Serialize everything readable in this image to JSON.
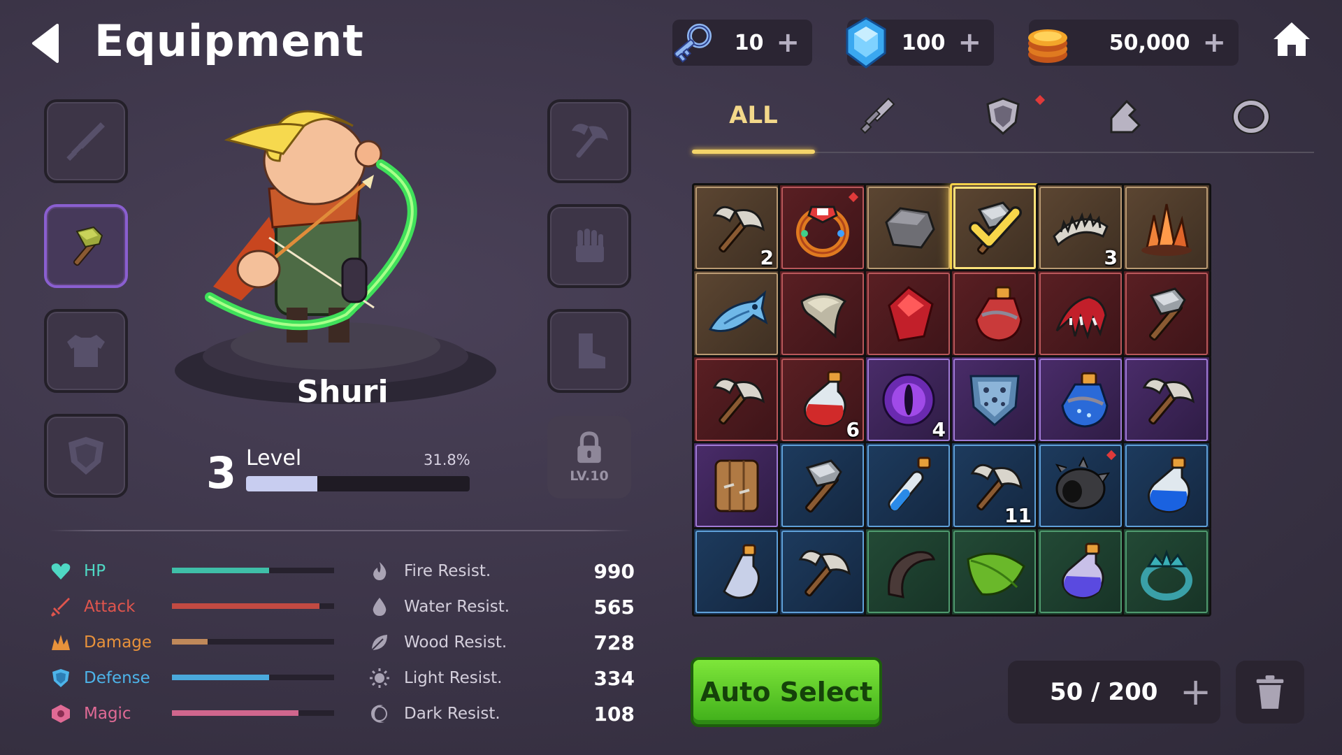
{
  "header": {
    "title": "Equipment",
    "currencies": [
      {
        "name": "keys",
        "icon": "key-icon",
        "value": "10"
      },
      {
        "name": "gems",
        "icon": "gem-icon",
        "value": "100"
      },
      {
        "name": "coins",
        "icon": "coin-icon",
        "value": "50,000"
      }
    ],
    "plus": "+"
  },
  "equipment_slots": {
    "left": [
      "sword-slot-icon",
      "hammer-slot-icon",
      "armor-slot-icon",
      "shield-slot-icon"
    ],
    "right": [
      "axe-slot-icon",
      "glove-slot-icon",
      "boot-slot-icon"
    ],
    "active": "hammer-slot-icon",
    "locked_slot_label": "LV.10"
  },
  "character": {
    "name": "Shuri",
    "level": "3",
    "level_label": "Level",
    "progress_text": "31.8%",
    "progress": 0.318
  },
  "stats": [
    {
      "label": "HP",
      "color": "#4fd8c4",
      "bar_color": "#3fbfa8",
      "fill": 0.6
    },
    {
      "label": "Attack",
      "color": "#e0554d",
      "bar_color": "#c24a42",
      "fill": 0.91
    },
    {
      "label": "Damage",
      "color": "#e8923b",
      "bar_color": "#c0895a",
      "fill": 0.22
    },
    {
      "label": "Defense",
      "color": "#4db4ea",
      "bar_color": "#4aa9dc",
      "fill": 0.6
    },
    {
      "label": "Magic",
      "color": "#e06a95",
      "bar_color": "#d0668d",
      "fill": 0.78
    }
  ],
  "resists": [
    {
      "label": "Fire Resist.",
      "value": "990",
      "icon": "fire-icon"
    },
    {
      "label": "Water Resist.",
      "value": "565",
      "icon": "water-drop-icon"
    },
    {
      "label": "Wood Resist.",
      "value": "728",
      "icon": "leaf-icon"
    },
    {
      "label": "Light Resist.",
      "value": "334",
      "icon": "sun-icon"
    },
    {
      "label": "Dark Resist.",
      "value": "108",
      "icon": "moon-icon"
    }
  ],
  "tabs": {
    "all": "ALL",
    "icons": [
      "sword-tab-icon",
      "shield-tab-icon",
      "boot-tab-icon",
      "ring-tab-icon"
    ]
  },
  "inventory": {
    "items": [
      {
        "icon": "axe-icon",
        "rarity": "brown",
        "count": "2"
      },
      {
        "icon": "ring-icon",
        "rarity": "red",
        "dot": true
      },
      {
        "icon": "stone-icon",
        "rarity": "brown"
      },
      {
        "icon": "hammer-icon",
        "rarity": "brown",
        "selected": true
      },
      {
        "icon": "jaw-trap-icon",
        "rarity": "brown",
        "count": "3"
      },
      {
        "icon": "crystal-cluster-icon",
        "rarity": "brown"
      },
      {
        "icon": "fish-icon",
        "rarity": "brown"
      },
      {
        "icon": "fang-icon",
        "rarity": "red"
      },
      {
        "icon": "ruby-icon",
        "rarity": "red"
      },
      {
        "icon": "red-jar-icon",
        "rarity": "red"
      },
      {
        "icon": "claw-icon",
        "rarity": "red"
      },
      {
        "icon": "hammer-icon",
        "rarity": "red"
      },
      {
        "icon": "axe-icon",
        "rarity": "red"
      },
      {
        "icon": "red-potion-icon",
        "rarity": "red",
        "count": "6"
      },
      {
        "icon": "eye-orb-icon",
        "rarity": "purple",
        "count": "4"
      },
      {
        "icon": "spiked-shield-icon",
        "rarity": "purple"
      },
      {
        "icon": "blue-jar-icon",
        "rarity": "purple"
      },
      {
        "icon": "axe-icon",
        "rarity": "purple"
      },
      {
        "icon": "wood-shield-icon",
        "rarity": "purple"
      },
      {
        "icon": "hammer-icon",
        "rarity": "blue"
      },
      {
        "icon": "blue-vial-icon",
        "rarity": "blue"
      },
      {
        "icon": "axe-icon",
        "rarity": "blue",
        "count": "11"
      },
      {
        "icon": "cannon-icon",
        "rarity": "blue",
        "dot": true
      },
      {
        "icon": "blue-potion-icon",
        "rarity": "blue"
      },
      {
        "icon": "vial-icon",
        "rarity": "blue"
      },
      {
        "icon": "axe-icon",
        "rarity": "blue"
      },
      {
        "icon": "horn-icon",
        "rarity": "green"
      },
      {
        "icon": "leaf-item-icon",
        "rarity": "green"
      },
      {
        "icon": "purple-potion-icon",
        "rarity": "green"
      },
      {
        "icon": "crown-ring-icon",
        "rarity": "green"
      }
    ]
  },
  "bottom": {
    "auto_select": "Auto Select",
    "capacity": "50 / 200",
    "plus": "+"
  }
}
